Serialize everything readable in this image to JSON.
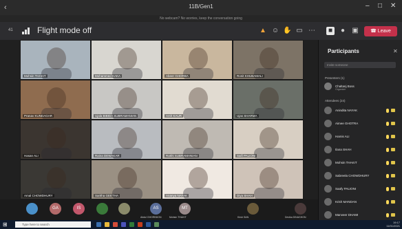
{
  "window": {
    "title": "11B/Gen1",
    "notice": "No webcam? No worries, keep the conversation going",
    "back_icon": "back-arrow-icon",
    "controls": [
      "minimize",
      "maximize",
      "close"
    ]
  },
  "meeting": {
    "timer": "41",
    "network_status": "Flight mode off",
    "leave_label": "Leave",
    "leave_color": "#c4314b"
  },
  "tiles": [
    {
      "name": "Mohsin THAKIT",
      "bg": "#a9b4bd"
    },
    {
      "name": "Mohammed KAKA",
      "bg": "#d8d6d0"
    },
    {
      "name": "Abeer GHORBA",
      "bg": "#c9b79e"
    },
    {
      "name": "Ronit KHUBAMALI",
      "bg": "#7d7366"
    },
    {
      "name": "Pranav KUNDAGAR",
      "bg": "#8f6c4f"
    },
    {
      "name": "Ujala BIBIDA SUBRAMANIAN",
      "bg": "#c8c7c4"
    },
    {
      "name": "Arsh KAUR",
      "bg": "#e1dbd1"
    },
    {
      "name": "Ujas SHARMA",
      "bg": "#6a6f68"
    },
    {
      "name": "Hasan ALI",
      "bg": "#3b3530"
    },
    {
      "name": "Raina DEWAKAR",
      "bg": "#b9bcc0"
    },
    {
      "name": "Rakhi SUBRAMANIAN",
      "bg": "#bfbab3"
    },
    {
      "name": "Saifi PALIONI",
      "bg": "#d8cfc3"
    },
    {
      "name": "Amal CHOWDHURY",
      "bg": "#3a3834"
    },
    {
      "name": "Saritha GEETHA",
      "bg": "#9a9083"
    },
    {
      "name": "Ananya NAYAK",
      "bg": "#f0e9e2"
    },
    {
      "name": "Diya SHAH",
      "bg": "#cfc3b8"
    }
  ],
  "strip": [
    {
      "initials": "",
      "color": "#4a90c9",
      "label": ""
    },
    {
      "initials": "GA",
      "color": "#b36a6a",
      "label": ""
    },
    {
      "initials": "IS",
      "color": "#c2576b",
      "label": ""
    },
    {
      "initials": "",
      "color": "#3a7a3a",
      "label": ""
    },
    {
      "initials": "",
      "color": "#8a8a6a",
      "label": ""
    },
    {
      "initials": "AS",
      "color": "#5b6e9a",
      "label": "Abdul GHORBDON"
    },
    {
      "initials": "MT",
      "color": "#9a8a8a",
      "label": "Mohsin THAKIT"
    },
    {
      "initials": "",
      "color": "#6a5a3a",
      "label": "Kirsh SAN"
    },
    {
      "initials": "",
      "color": "#4a3a3a",
      "label": "Devika DINAGHON"
    }
  ],
  "panel": {
    "title": "Participants",
    "invite_placeholder": "Invite someone",
    "presenters_label": "Presenters (1)",
    "attendees_label": "Attendees (24)",
    "organizer": {
      "name": "Chaltanj Boss",
      "role": "Organizer"
    },
    "attendees": [
      "Anindita NAYAK",
      "Aimee GHOTRA",
      "Hamis ALI",
      "Ilana SHAH",
      "Mohsin THAKIT",
      "Sabreela CHOWDHURY",
      "Saafy PALIONI",
      "Krish MANDAN",
      "Manveer DHAMI"
    ]
  },
  "taskbar": {
    "search_placeholder": "Type here to search",
    "time": "19:17",
    "date": "11/01/2021"
  }
}
